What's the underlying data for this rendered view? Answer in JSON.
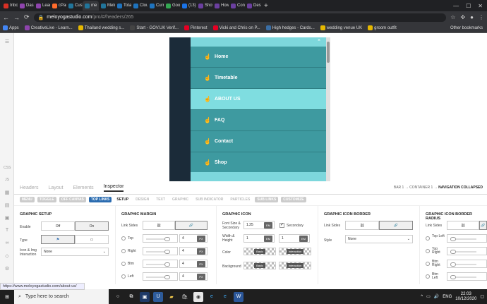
{
  "browser": {
    "tabs": [
      {
        "label": "Inbox",
        "color": "#d93025"
      },
      {
        "label": "Dashb",
        "color": "#8e44ad"
      },
      {
        "label": "Learn",
        "color": "#8e44ad"
      },
      {
        "label": "cPanel",
        "color": "#ff6c2c"
      },
      {
        "label": "Custo",
        "color": "#21759b"
      },
      {
        "label": "me",
        "color": "#21759b"
      },
      {
        "label": "Melo",
        "color": "#21759b"
      },
      {
        "label": "Total",
        "color": "#1e73be"
      },
      {
        "label": "Cloud",
        "color": "#1e73be"
      },
      {
        "label": "Curre",
        "color": "#1e73be"
      },
      {
        "label": "Googl",
        "color": "#34a853"
      },
      {
        "label": "(13) C",
        "color": "#1a73e8"
      },
      {
        "label": "Show",
        "color": "#6b3fa0"
      },
      {
        "label": "How t",
        "color": "#6b3fa0"
      },
      {
        "label": "Conve",
        "color": "#6b3fa0"
      },
      {
        "label": "Design",
        "color": "#6b3fa0"
      }
    ],
    "active_tab_index": 5,
    "url_host": "meloyogastudio.com",
    "url_path": "/pro/#/headers/265",
    "bookmarks": [
      {
        "label": "Apps",
        "color": "#4285f4"
      },
      {
        "label": "CreativeLive - Learn...",
        "color": "#8e44ad"
      },
      {
        "label": "Thailand wedding s...",
        "color": "#e6b800"
      },
      {
        "label": "Start - GOV.UK Verif...",
        "color": "#444"
      },
      {
        "label": "Pinterest",
        "color": "#e60023"
      },
      {
        "label": "Vicki and Chris on P...",
        "color": "#e60023"
      },
      {
        "label": "High hedges - Cards...",
        "color": "#3a6ea5"
      },
      {
        "label": "wedding venue UK",
        "color": "#e6b800"
      },
      {
        "label": "groom outfit",
        "color": "#e6b800"
      }
    ],
    "other_bookmarks": "Other bookmarks"
  },
  "preview_menu": {
    "close_label": "×",
    "items": [
      "Home",
      "Timetable",
      "ABOUT US",
      "FAQ",
      "Contact",
      "Shop"
    ],
    "active_index": 2
  },
  "sidebar_labels": {
    "css": "CSS",
    "js": "JS"
  },
  "panel": {
    "tabs": [
      "Headers",
      "Layout",
      "Elements",
      "Inspector"
    ],
    "active_tab": "Inspector",
    "breadcrumb": {
      "path": "BAR 1 → CONTAINER 1 → ",
      "current": "NAVIGATION COLLAPSED"
    },
    "subtabs": [
      "MENU",
      "TOGGLE",
      "OFF CANVAS",
      "TOP LINKS",
      "SETUP",
      "DESIGN",
      "TEXT",
      "GRAPHIC",
      "SUB INDICATOR",
      "PARTICLES",
      "SUB LINKS",
      "CUSTOMIZE"
    ]
  },
  "graphic_setup": {
    "title": "GRAPHIC SETUP",
    "enable_label": "Enable",
    "off": "Off",
    "on": "On",
    "type_label": "Type",
    "icon_img_label": "Icon & Img Interaction",
    "interaction_value": "None"
  },
  "graphic_margin": {
    "title": "GRAPHIC MARGIN",
    "link_sides": "Link Sides",
    "rows": [
      {
        "label": "Top",
        "value": "4",
        "unit": "PX"
      },
      {
        "label": "Right",
        "value": "4",
        "unit": "PX"
      },
      {
        "label": "Btm",
        "value": "4",
        "unit": "PX"
      },
      {
        "label": "Left",
        "value": "4",
        "unit": "PX"
      }
    ]
  },
  "graphic_icon": {
    "title": "GRAPHIC ICON",
    "font_size_label": "Font Size & Secondary",
    "font_size": "1.25",
    "font_unit": "EM",
    "secondary_label": "Secondary",
    "width_label": "Width & Height",
    "width": "1",
    "height": "1",
    "width_unit": "EM",
    "height_unit": "EM",
    "color_label": "Color",
    "background_label": "Background",
    "basic": "Basic",
    "interaction": "Interaction"
  },
  "graphic_icon_border": {
    "title": "GRAPHIC ICON BORDER",
    "link_sides": "Link Sides",
    "style_label": "Style",
    "style_value": "None"
  },
  "graphic_icon_border_radius": {
    "title": "GRAPHIC ICON BORDER RADIUS",
    "link_sides": "Link Sides",
    "rows": [
      "Top Left",
      "Top Right",
      "Btm Right",
      "Btm Left"
    ]
  },
  "status_url": "https://www.meloyogastudio.com/about-us/",
  "taskbar": {
    "search_placeholder": "Type here to search",
    "language": "ENG",
    "time": "22:03",
    "date": "10/12/2020"
  }
}
